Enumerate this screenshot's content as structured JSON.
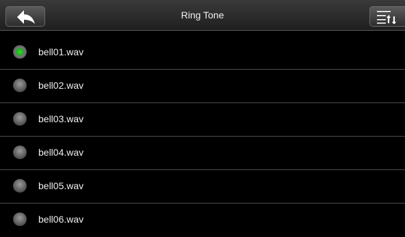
{
  "header": {
    "title": "Ring Tone",
    "back_icon": "back-arrow-icon",
    "sort_icon": "sort-list-icon"
  },
  "colors": {
    "background": "#000000",
    "selected_radio": "#22c022",
    "divider": "#4d4d4d"
  },
  "list": {
    "selected_index": 0,
    "items": [
      {
        "label": "bell01.wav",
        "selected": true
      },
      {
        "label": "bell02.wav",
        "selected": false
      },
      {
        "label": "bell03.wav",
        "selected": false
      },
      {
        "label": "bell04.wav",
        "selected": false
      },
      {
        "label": "bell05.wav",
        "selected": false
      },
      {
        "label": "bell06.wav",
        "selected": false
      }
    ]
  }
}
